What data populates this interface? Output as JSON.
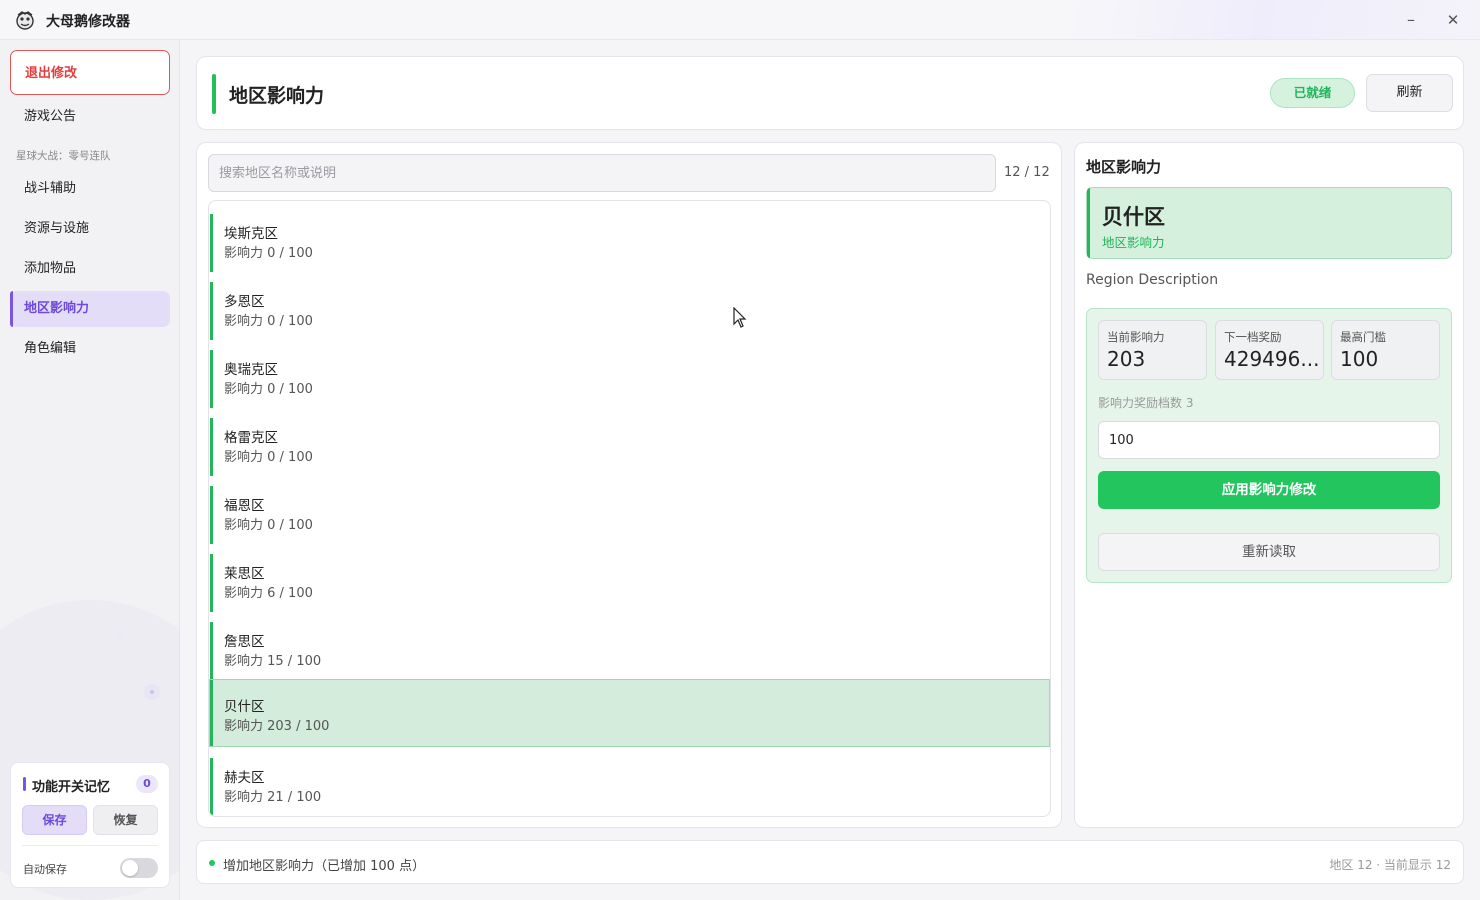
{
  "window": {
    "title": "大母鹅修改器",
    "minimize": "–",
    "close": "✕"
  },
  "sidebar": {
    "exit_label": "退出修改",
    "announce_label": "游戏公告",
    "group_label": "星球大战：零号连队",
    "items": [
      {
        "label": "战斗辅助"
      },
      {
        "label": "资源与设施"
      },
      {
        "label": "添加物品"
      },
      {
        "label": "地区影响力"
      },
      {
        "label": "角色编辑"
      }
    ],
    "memory": {
      "title": "功能开关记忆",
      "count": "0",
      "save_label": "保存",
      "restore_label": "恢复",
      "auto_save_label": "自动保存",
      "auto_save_on": false
    }
  },
  "header": {
    "title": "地区影响力",
    "status_badge": "已就绪",
    "refresh_label": "刷新"
  },
  "list": {
    "search_placeholder": "搜索地区名称或说明",
    "search_value": "",
    "count": "12 / 12",
    "regions": [
      {
        "name": "埃斯克区",
        "value": "影响力 0 / 100"
      },
      {
        "name": "多恩区",
        "value": "影响力 0 / 100"
      },
      {
        "name": "奥瑞克区",
        "value": "影响力 0 / 100"
      },
      {
        "name": "格雷克区",
        "value": "影响力 0 / 100"
      },
      {
        "name": "福恩区",
        "value": "影响力 0 / 100"
      },
      {
        "name": "莱思区",
        "value": "影响力 6 / 100"
      },
      {
        "name": "詹思区",
        "value": "影响力 15 / 100"
      },
      {
        "name": "贝什区",
        "value": "影响力 203 / 100",
        "selected": true
      },
      {
        "name": "赫夫区",
        "value": "影响力 21 / 100"
      }
    ]
  },
  "detail": {
    "heading": "地区影响力",
    "selected_name": "贝什区",
    "selected_sub": "地区影响力",
    "description": "Region Description",
    "stats": [
      {
        "label": "当前影响力",
        "value": "203"
      },
      {
        "label": "下一档奖励",
        "value": "429496..."
      },
      {
        "label": "最高门槛",
        "value": "100"
      }
    ],
    "tier_label": "影响力奖励档数 3",
    "input_value": "100",
    "apply_label": "应用影响力修改",
    "reread_label": "重新读取"
  },
  "status": {
    "message": "增加地区影响力（已增加 100 点）",
    "summary": "地区 12 · 当前显示 12"
  },
  "colors": {
    "accent_green": "#22c55e",
    "accent_purple": "#7a55e0",
    "danger_red": "#e23e3e"
  }
}
